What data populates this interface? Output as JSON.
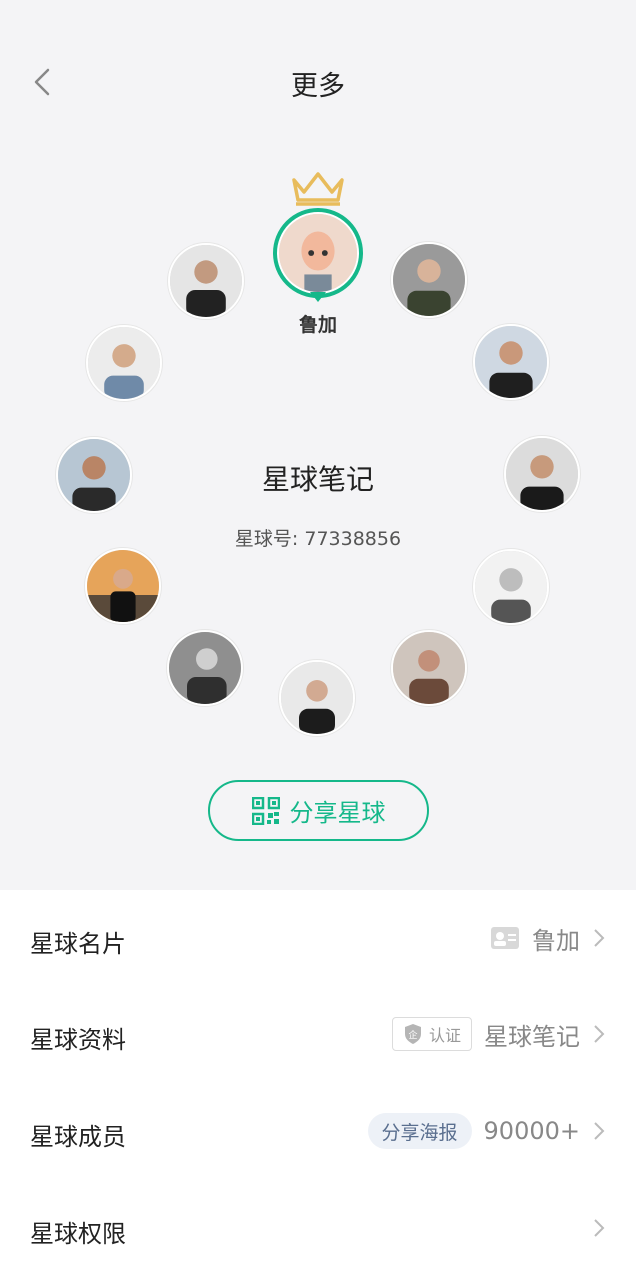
{
  "nav": {
    "title": "更多",
    "back_icon": "chevron-left-icon"
  },
  "owner": {
    "name": "鲁加",
    "crown_icon": "crown-icon",
    "ring_color": "#15b88a"
  },
  "planet": {
    "name": "星球笔记",
    "id_text": "星球号: 77338856"
  },
  "members_count": 12,
  "share": {
    "label": "分享星球",
    "icon": "qrcode-icon",
    "color": "#15b88a"
  },
  "rows": [
    {
      "title": "星球名片",
      "value": "鲁加",
      "icon": "id-card-icon"
    },
    {
      "title": "星球资料",
      "badge": "认证",
      "badge_icon": "enterprise-shield-icon",
      "value": "星球笔记"
    },
    {
      "title": "星球成员",
      "pill": "分享海报",
      "value": "90000+"
    },
    {
      "title": "星球权限"
    }
  ],
  "colors": {
    "accent": "#15b88a",
    "crown": "#e8bc5c",
    "background": "#f4f4f6"
  }
}
